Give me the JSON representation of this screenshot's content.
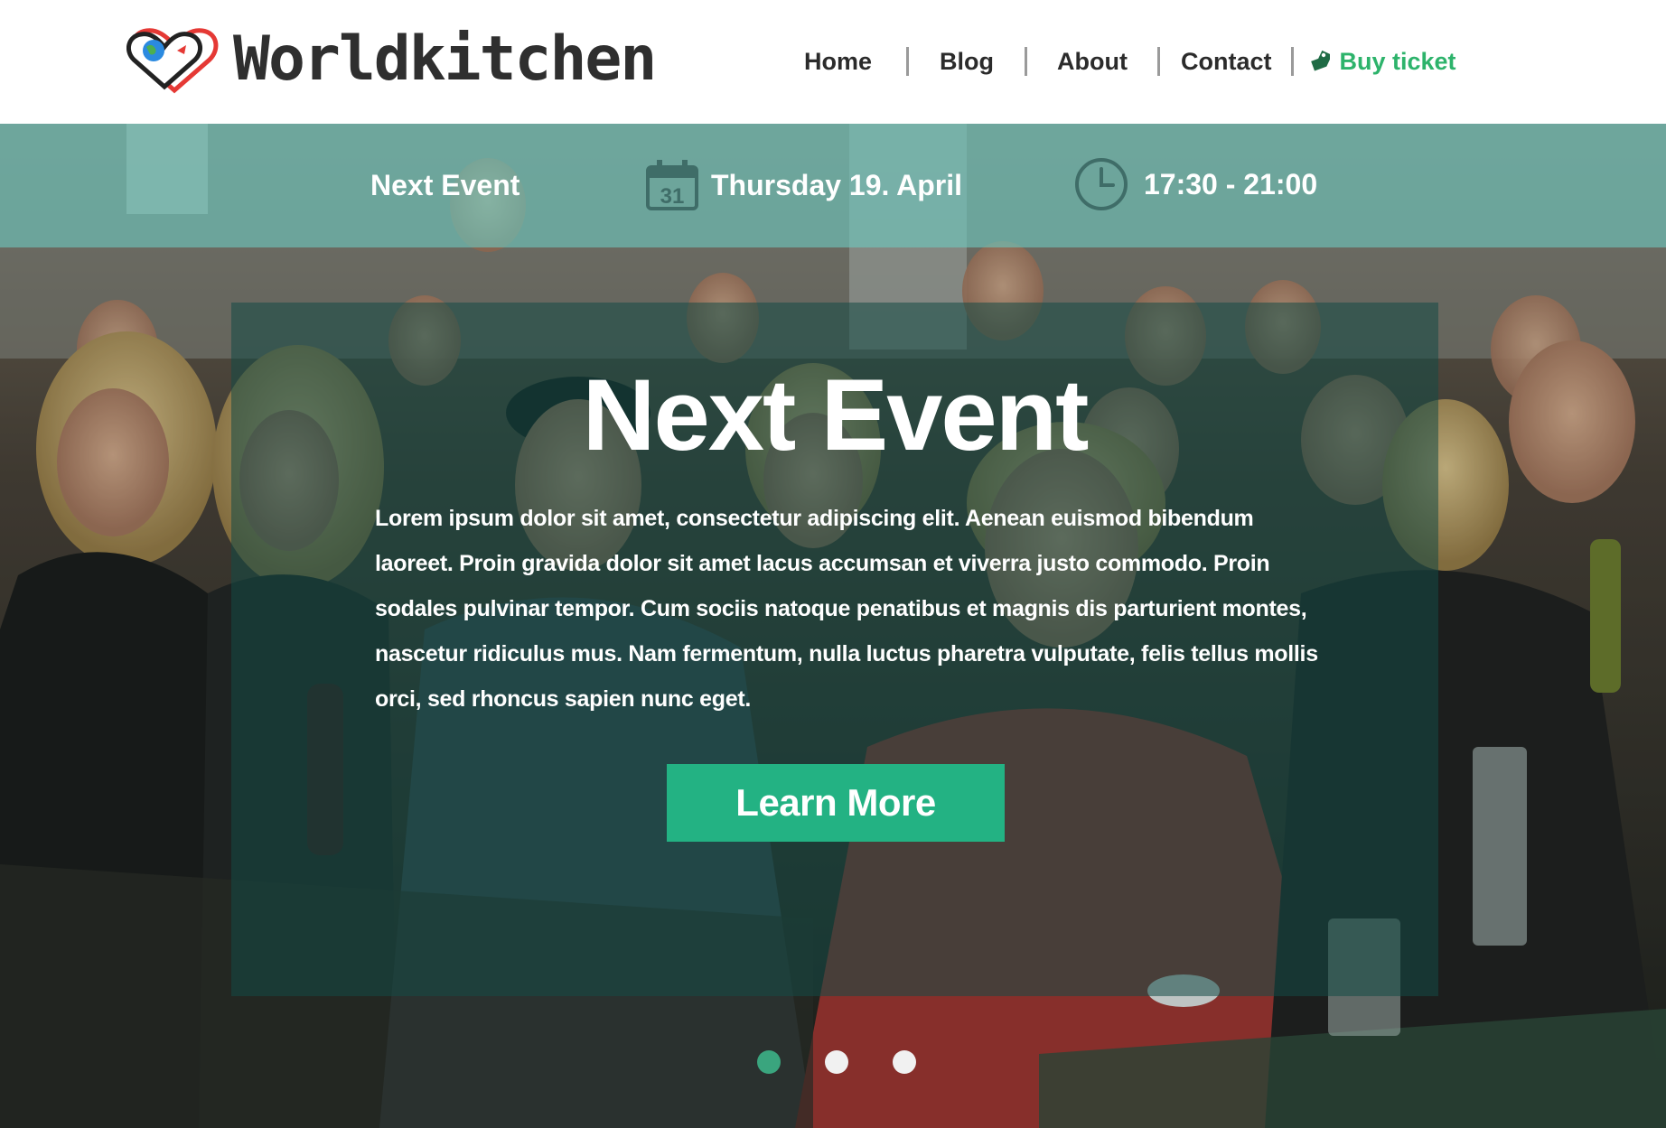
{
  "brand": {
    "name": "Worldkitchen"
  },
  "nav": {
    "items": [
      {
        "label": "Home"
      },
      {
        "label": "Blog"
      },
      {
        "label": "About"
      },
      {
        "label": "Contact"
      }
    ],
    "buy_ticket": {
      "label": "Buy ticket",
      "icon": "price-tag-icon",
      "color": "#2db36b"
    }
  },
  "event_bar": {
    "label": "Next Event",
    "date": "Thursday 19. April",
    "date_icon": "calendar-icon",
    "calendar_day": "31",
    "time": "17:30 - 21:00",
    "time_icon": "clock-icon"
  },
  "hero": {
    "title": "Next Event",
    "body": "Lorem ipsum dolor sit amet, consectetur adipiscing elit. Aenean euismod bibendum laoreet. Proin gravida dolor sit amet lacus accumsan et viverra justo commodo. Proin sodales pulvinar tempor. Cum sociis natoque penatibus et magnis dis parturient montes, nascetur ridiculus mus. Nam fermentum, nulla luctus pharetra vulputate, felis tellus mollis orci, sed rhoncus sapien nunc eget.",
    "cta_label": "Learn More",
    "accent_color": "#23b283"
  },
  "carousel": {
    "slide_count": 3,
    "active_index": 0
  }
}
